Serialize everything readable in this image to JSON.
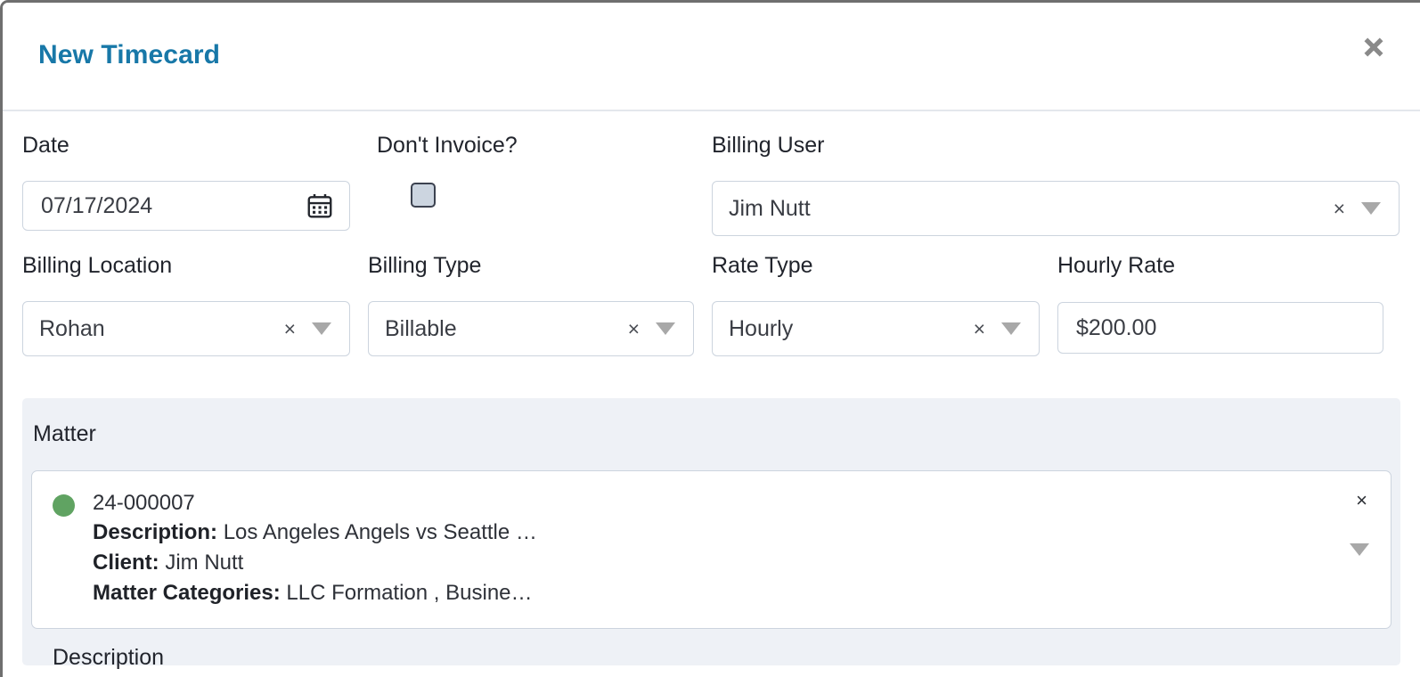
{
  "dialog": {
    "title": "New Timecard",
    "close_icon": "close-icon"
  },
  "form": {
    "date": {
      "label": "Date",
      "value": "07/17/2024",
      "icon": "calendar-icon"
    },
    "dont_invoice": {
      "label": "Don't Invoice?",
      "checked": false
    },
    "billing_user": {
      "label": "Billing User",
      "value": "Jim Nutt",
      "clear": "×",
      "caret": "▼"
    },
    "billing_location": {
      "label": "Billing Location",
      "value": "Rohan",
      "clear": "×",
      "caret": "▼"
    },
    "billing_type": {
      "label": "Billing Type",
      "value": "Billable",
      "clear": "×",
      "caret": "▼"
    },
    "rate_type": {
      "label": "Rate Type",
      "value": "Hourly",
      "clear": "×",
      "caret": "▼"
    },
    "hourly_rate": {
      "label": "Hourly Rate",
      "value": "$200.00"
    }
  },
  "matter": {
    "heading": "Matter",
    "status_color": "#60a362",
    "id": "24-000007",
    "description_label": "Description:",
    "description_value": "Los Angeles Angels vs Seattle …",
    "client_label": "Client:",
    "client_value": "Jim Nutt",
    "categories_label": "Matter Categories:",
    "categories_value": "LLC Formation , Busine…",
    "clear": "×",
    "caret": "▼"
  },
  "next_section": {
    "label": "Description"
  },
  "colors": {
    "title": "#1878a8",
    "panel_bg": "#eef1f6",
    "border": "#ccd4de",
    "status_green": "#60a362"
  }
}
